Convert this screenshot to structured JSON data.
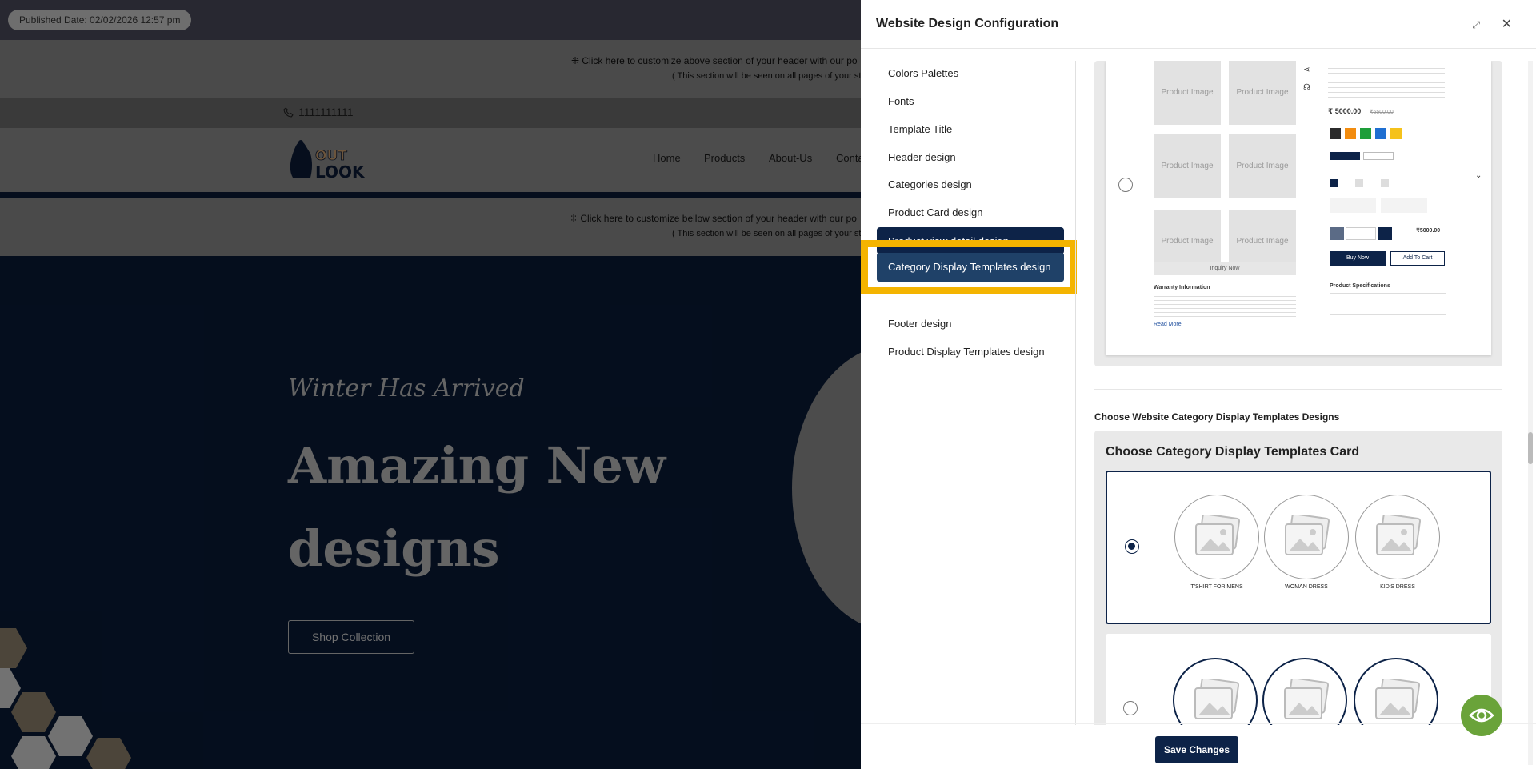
{
  "site": {
    "published_date": "Published Date: 02/02/2026 12:57 pm",
    "header_customize_above": "⁜ Click here to customize above section of your header with our po",
    "header_customize_above_note": "( This section will be seen on all pages of your store",
    "phone": "1111111111",
    "logo_text": "OUT LOOK",
    "nav": [
      "Home",
      "Products",
      "About-Us",
      "Conta"
    ],
    "header_customize_below": "⁜ Click here to customize bellow section of your header with our po",
    "header_customize_below_note": "( This section will be seen on all pages of your store",
    "hero": {
      "tagline": "Winter Has Arrived",
      "title": "Amazing New designs",
      "cta": "Shop Collection"
    }
  },
  "panel": {
    "title": "Website Design Configuration",
    "menu": [
      "Colors Palettes",
      "Fonts",
      "Template Title",
      "Header design",
      "Categories design",
      "Product Card design",
      "Product view detail design",
      "Category Display Templates design",
      "Product Display Templates design",
      "Footer design"
    ],
    "active_menu": "Category Display Templates design",
    "product_preview": {
      "image_placeholder": "Product Image",
      "price": "₹ 5000.00",
      "old_price": "₹6500.00",
      "buy_now": "Buy Now",
      "add_to_cart": "Add To Cart",
      "inquiry": "Inquiry Now",
      "warranty": "Warranty Information",
      "specs": "Product Specifications",
      "side_price": "₹5000.00",
      "read_more": "Read More",
      "swatches": [
        "#2b2b2b",
        "#f28c0f",
        "#1e9e3a",
        "#1f6fd1",
        "#f5c21b"
      ]
    },
    "section_label": "Choose Website Category Display Templates Designs",
    "category_card": {
      "title": "Choose Category Display Templates Card",
      "labels": [
        "T'SHIRT FOR MENS",
        "WOMAN DRESS",
        "KID'S DRESS"
      ]
    },
    "save_label": "Save Changes"
  }
}
